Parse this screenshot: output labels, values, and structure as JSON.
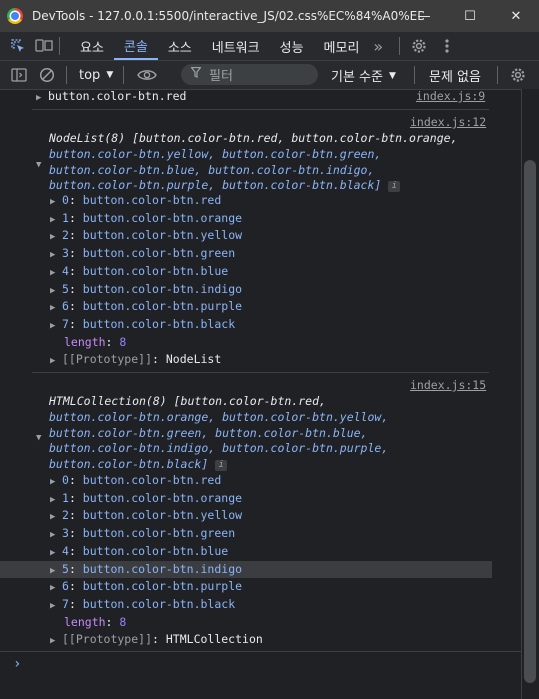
{
  "titlebar": {
    "title": "DevTools - 127.0.0.1:5500/interactive_JS/02.css%EC%84%A0%ED%8...",
    "minimize": "—",
    "maximize": "☐",
    "close": "✕"
  },
  "tabs": [
    "요소",
    "콘솔",
    "소스",
    "네트워크",
    "성능",
    "메모리"
  ],
  "more_tabs": "»",
  "toolbar": {
    "context": "top",
    "filter_placeholder": "필터",
    "level": "기본 수준",
    "issues": "문제 없음"
  },
  "console": {
    "first_line": {
      "text": "button.color-btn.red",
      "source": "index.js:9"
    },
    "nodelist": {
      "source": "index.js:12",
      "preview_lines": [
        "NodeList(8) [button.color-btn.red, button.color-btn.orange,",
        "button.color-btn.yellow, button.color-btn.green,",
        "button.color-btn.blue, button.color-btn.indigo,",
        "button.color-btn.purple, button.color-btn.black]"
      ],
      "items": [
        {
          "index": "0",
          "value": "button.color-btn.red"
        },
        {
          "index": "1",
          "value": "button.color-btn.orange"
        },
        {
          "index": "2",
          "value": "button.color-btn.yellow"
        },
        {
          "index": "3",
          "value": "button.color-btn.green"
        },
        {
          "index": "4",
          "value": "button.color-btn.blue"
        },
        {
          "index": "5",
          "value": "button.color-btn.indigo"
        },
        {
          "index": "6",
          "value": "button.color-btn.purple"
        },
        {
          "index": "7",
          "value": "button.color-btn.black"
        }
      ],
      "length_label": "length",
      "length_value": "8",
      "prototype_label": "[[Prototype]]",
      "prototype_value": "NodeList"
    },
    "htmlcollection": {
      "source": "index.js:15",
      "preview_lines": [
        "HTMLCollection(8) [button.color-btn.red,",
        "button.color-btn.orange, button.color-btn.yellow,",
        "button.color-btn.green, button.color-btn.blue,",
        "button.color-btn.indigo, button.color-btn.purple,",
        "button.color-btn.black]"
      ],
      "items": [
        {
          "index": "0",
          "value": "button.color-btn.red"
        },
        {
          "index": "1",
          "value": "button.color-btn.orange"
        },
        {
          "index": "2",
          "value": "button.color-btn.yellow"
        },
        {
          "index": "3",
          "value": "button.color-btn.green"
        },
        {
          "index": "4",
          "value": "button.color-btn.blue"
        },
        {
          "index": "5",
          "value": "button.color-btn.indigo"
        },
        {
          "index": "6",
          "value": "button.color-btn.purple"
        },
        {
          "index": "7",
          "value": "button.color-btn.black"
        }
      ],
      "length_label": "length",
      "length_value": "8",
      "prototype_label": "[[Prototype]]",
      "prototype_value": "HTMLCollection"
    },
    "prompt": "›"
  },
  "colors": {
    "accent": "#8ab4f8",
    "background": "#202124",
    "panel": "#292a2d",
    "number": "#9980ff"
  }
}
